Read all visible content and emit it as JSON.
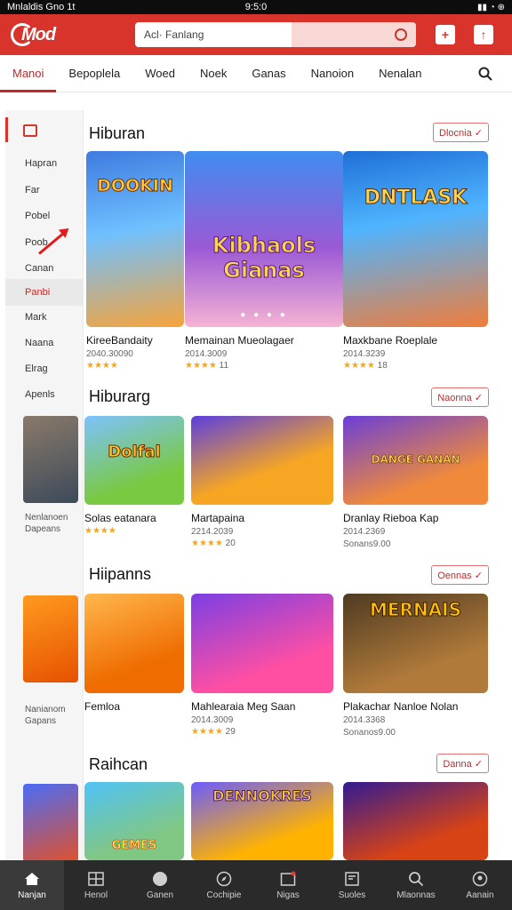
{
  "status_bar": {
    "left": "Mnlaldis Gno 1t",
    "center": "9:5:0",
    "right": "▮▮ ◔ ⊕"
  },
  "header": {
    "logo_text": "Mod",
    "search_placeholder": "Acl· Fanlang"
  },
  "tabs": [
    {
      "label": "Manoi"
    },
    {
      "label": "Bepoplela"
    },
    {
      "label": "Woed"
    },
    {
      "label": "Noek"
    },
    {
      "label": "Ganas"
    },
    {
      "label": "Nanoion"
    },
    {
      "label": "Nenalan"
    }
  ],
  "sidebar": {
    "items": [
      "Hapran",
      "Far",
      "Pobel",
      "Poob",
      "Canan",
      "Panbi",
      "Mark",
      "Naana",
      "Elrag",
      "Apenls"
    ],
    "captions": [
      {
        "line1": "Nenlanoen",
        "line2": "Dapeans"
      },
      {
        "line1": "Nanianom",
        "line2": "Gapans"
      }
    ]
  },
  "sections": [
    {
      "title": "Hiburan",
      "more": "Dlocnia ✓",
      "cards": [
        {
          "art": "DOOKIN",
          "name": "KireeBandaity",
          "meta": "2040.30090",
          "stars": "★★★★",
          "count": ""
        },
        {
          "art": "Kibhaols Gianas",
          "name": "Memainan Mueolagaer",
          "meta": "2014.3009",
          "stars": "★★★★",
          "count": "11"
        },
        {
          "art": "DNTLASK",
          "name": "Maxkbane Roeplale",
          "meta": "2014.3239",
          "stars": "★★★★",
          "count": "18"
        }
      ]
    },
    {
      "title": "Hiburarg",
      "more": "Naonna ✓",
      "cards": [
        {
          "art": "Dolfal",
          "name": "Solas eatanara",
          "meta": "",
          "stars": "★★★★",
          "count": ""
        },
        {
          "art": "",
          "name": "Martapaina",
          "meta": "2214.2039",
          "stars": "★★★★",
          "count": "20"
        },
        {
          "art": "DANGE GANAN",
          "name": "Dranlay Rieboa Kap",
          "meta": "2014.2369",
          "stars": "",
          "count": "Sonans9.00"
        }
      ]
    },
    {
      "title": "Hiipanns",
      "more": "Oennas ✓",
      "cards": [
        {
          "art": "",
          "name": "Femloa",
          "meta": "",
          "stars": "",
          "count": ""
        },
        {
          "art": "",
          "name": "Mahlearaia Meg Saan",
          "meta": "2014.3009",
          "stars": "★★★★",
          "count": "29"
        },
        {
          "art": "MERNAIS",
          "name": "Plakachar Nanloe Nolan",
          "meta": "2014.3368",
          "stars": "",
          "count": "Sonanos9.00"
        }
      ]
    },
    {
      "title": "Raihcan",
      "more": "Danna ✓",
      "cards": [
        {
          "art": "GEMES",
          "name": "",
          "meta": "",
          "stars": "",
          "count": ""
        },
        {
          "art": "DENNOKRES",
          "name": "",
          "meta": "",
          "stars": "",
          "count": ""
        },
        {
          "art": "",
          "name": "",
          "meta": "",
          "stars": "",
          "count": ""
        }
      ]
    }
  ],
  "bottom_nav": [
    {
      "label": "Nanjan",
      "icon": "home-icon"
    },
    {
      "label": "Henol",
      "icon": "grid-icon"
    },
    {
      "label": "Ganen",
      "icon": "games-icon"
    },
    {
      "label": "Cochipie",
      "icon": "compass-icon"
    },
    {
      "label": "Nigas",
      "icon": "calendar-icon"
    },
    {
      "label": "Suoles",
      "icon": "news-icon"
    },
    {
      "label": "Mlaonnas",
      "icon": "search-icon"
    },
    {
      "label": "Aanain",
      "icon": "profile-icon"
    }
  ],
  "colors": {
    "brand": "#d9342b",
    "accent": "#c62828",
    "nav_bg": "#2a2a2a"
  }
}
